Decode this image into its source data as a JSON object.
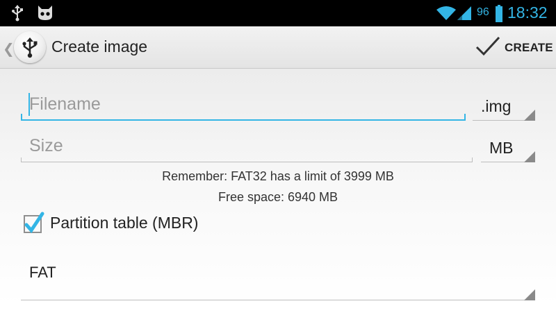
{
  "status_bar": {
    "battery_level": "96",
    "time": "18:32",
    "icons": [
      "usb-icon",
      "cyanogen-mascot-icon",
      "wifi-icon",
      "signal-icon",
      "battery-icon"
    ]
  },
  "action_bar": {
    "title": "Create image",
    "app_icon": "usb-icon",
    "create_label": "CREATE",
    "create_icon": "checkmark-icon"
  },
  "form": {
    "filename": {
      "placeholder": "Filename",
      "value": ""
    },
    "extension": {
      "selected": ".img"
    },
    "size": {
      "placeholder": "Size",
      "value": ""
    },
    "unit": {
      "selected": "MB"
    },
    "note_limit": "Remember: FAT32 has a limit of 3999 MB",
    "note_free": "Free space: 6940 MB",
    "partition_table": {
      "label": "Partition table (MBR)",
      "checked": true
    },
    "filesystem": {
      "selected": "FAT"
    }
  },
  "colors": {
    "accent": "#33b5e5",
    "status_bar": "#000000",
    "action_bar": "#e8e8e8"
  }
}
